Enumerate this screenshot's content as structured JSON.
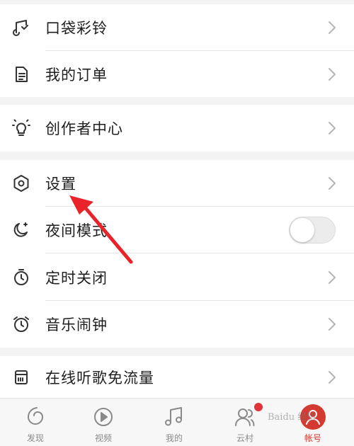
{
  "menu": {
    "group1": [
      {
        "label": "口袋彩铃",
        "icon": "ringtone-icon"
      },
      {
        "label": "我的订单",
        "icon": "order-icon"
      }
    ],
    "group2": [
      {
        "label": "创作者中心",
        "icon": "lightbulb-icon"
      }
    ],
    "group3": [
      {
        "label": "设置",
        "icon": "settings-icon"
      },
      {
        "label": "夜间模式",
        "icon": "moon-icon",
        "toggle": false
      },
      {
        "label": "定时关闭",
        "icon": "timer-icon"
      },
      {
        "label": "音乐闹钟",
        "icon": "alarm-icon"
      }
    ],
    "group4": [
      {
        "label": "在线听歌免流量",
        "icon": "sim-card-icon"
      }
    ]
  },
  "tabbar": {
    "tabs": [
      {
        "label": "发现",
        "icon": "discover-icon"
      },
      {
        "label": "视频",
        "icon": "video-icon"
      },
      {
        "label": "我的",
        "icon": "music-note-icon"
      },
      {
        "label": "云村",
        "icon": "community-icon",
        "badge": true
      },
      {
        "label": "帐号",
        "icon": "account-icon",
        "active": true
      }
    ]
  },
  "colors": {
    "accent": "#d33a31",
    "annotation_arrow": "#e8232a"
  },
  "watermark": "Baidu 经验"
}
